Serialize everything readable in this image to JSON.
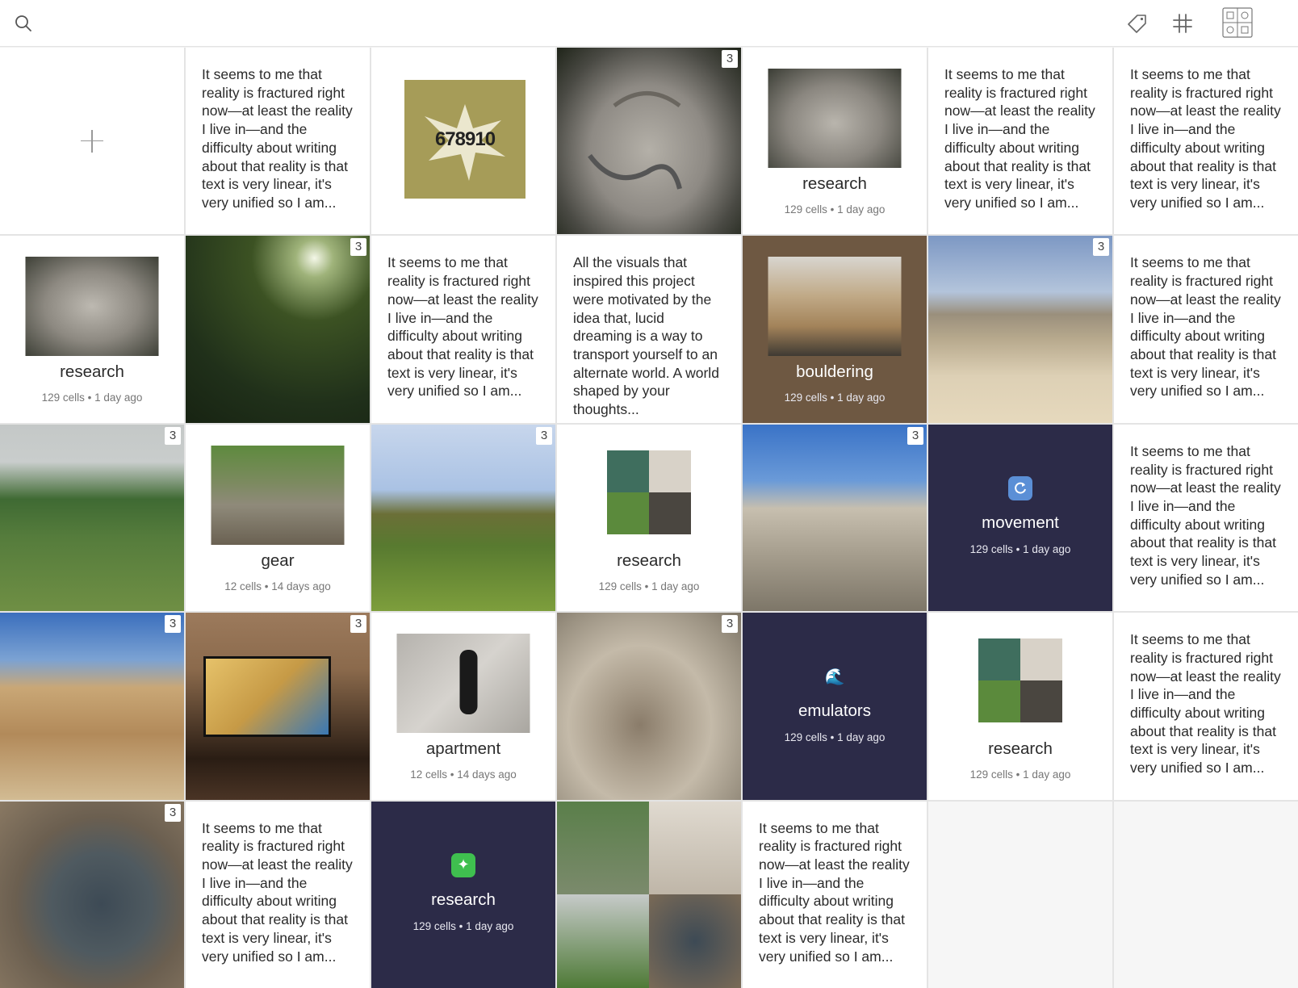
{
  "toolbar": {
    "search_icon": "search-icon",
    "tag_icon": "tag-icon",
    "hash_icon": "hash-icon",
    "layout_icon": "layout-icon"
  },
  "texts": {
    "reality": "It seems to me that reality is fractured right now—at least the reality I live in—and the difficulty about writing about that reality is that text is very linear, it's very unified so I am...",
    "visuals": "All the visuals that inspired this project were motivated by the idea that, lucid dreaming is a way to transport yourself to an alternate world. A world shaped by your thoughts..."
  },
  "badge": "3",
  "colors": {
    "dark_tile": "#2c2b48",
    "brown_tile": "#6e5842",
    "accent_green": "#3fbf4f"
  },
  "collections": {
    "r1": {
      "name": "research",
      "meta": "129 cells • 1 day ago"
    },
    "r2": {
      "name": "research",
      "meta": "129 cells • 1 day ago"
    },
    "bouldering": {
      "name": "bouldering",
      "meta": "129 cells • 1 day ago"
    },
    "gear": {
      "name": "gear",
      "meta": "12 cells • 14 days ago"
    },
    "r3": {
      "name": "research",
      "meta": "129 cells • 1 day ago"
    },
    "movement": {
      "name": "movement",
      "meta": "129 cells • 1 day ago",
      "icon": "refresh-icon"
    },
    "apartment": {
      "name": "apartment",
      "meta": "12 cells • 14 days ago"
    },
    "emulators": {
      "name": "emulators",
      "meta": "129 cells • 1 day ago",
      "icon": "wave-icon"
    },
    "r4": {
      "name": "research",
      "meta": "129 cells • 1 day ago"
    },
    "r5": {
      "name": "research",
      "meta": "129 cells • 1 day ago",
      "icon": "sparkle-icon"
    }
  },
  "artwork_numbers": "678910"
}
